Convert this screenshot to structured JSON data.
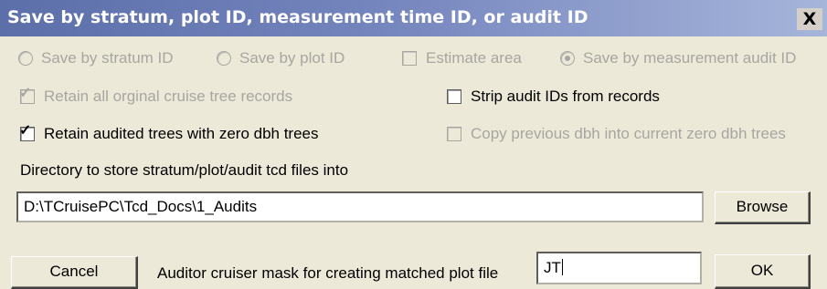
{
  "window": {
    "title": "Save by stratum, plot ID, measurement time ID, or audit ID",
    "close_label": "X"
  },
  "save_mode": {
    "options": [
      {
        "label": "Save by stratum ID",
        "selected": false,
        "enabled": false
      },
      {
        "label": "Save by plot ID",
        "selected": false,
        "enabled": false
      },
      {
        "label": "Save by measurement audit ID",
        "selected": true,
        "enabled": false
      }
    ],
    "estimate_area": {
      "label": "Estimate area",
      "checked": false,
      "enabled": false
    }
  },
  "options": {
    "retain_original": {
      "label": "Retain all orginal cruise tree records",
      "checked": true,
      "enabled": false
    },
    "strip_audit_ids": {
      "label": "Strip audit IDs from records",
      "checked": false,
      "enabled": true
    },
    "retain_zero_dbh": {
      "label": "Retain audited trees with zero dbh trees",
      "checked": true,
      "enabled": true
    },
    "copy_previous_dbh": {
      "label": "Copy previous dbh into current zero dbh trees",
      "checked": false,
      "enabled": false
    }
  },
  "directory": {
    "label": "Directory to store stratum/plot/audit tcd files into",
    "value": "D:\\TCruisePC\\Tcd_Docs\\1_Audits",
    "browse_label": "Browse"
  },
  "footer": {
    "cancel_label": "Cancel",
    "mask_label": "Auditor cruiser mask for creating matched plot file",
    "mask_value": "JT",
    "ok_label": "OK"
  }
}
